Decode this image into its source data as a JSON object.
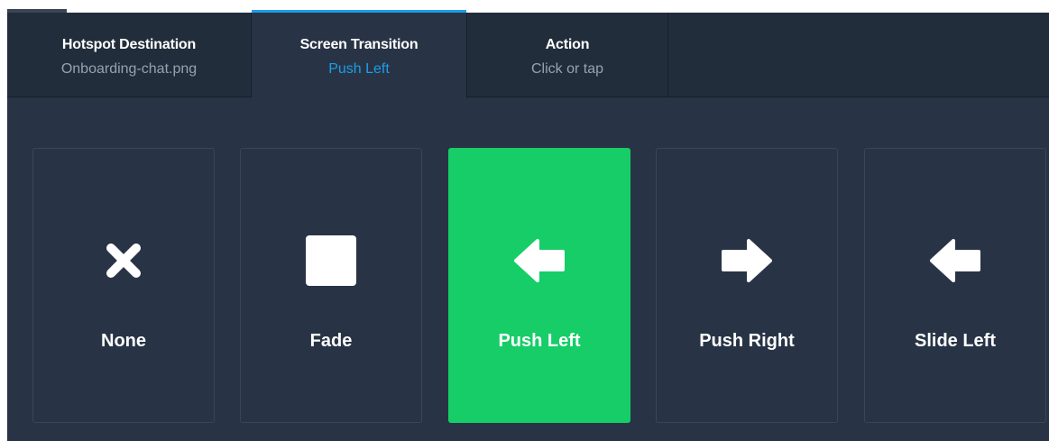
{
  "tabs": [
    {
      "title": "Hotspot Destination",
      "subtitle": "Onboarding-chat.png",
      "active": false
    },
    {
      "title": "Screen Transition",
      "subtitle": "Push Left",
      "active": true
    },
    {
      "title": "Action",
      "subtitle": "Click or tap",
      "active": false
    }
  ],
  "transitions": [
    {
      "label": "None",
      "icon": "close-icon",
      "selected": false
    },
    {
      "label": "Fade",
      "icon": "square-icon",
      "selected": false
    },
    {
      "label": "Push Left",
      "icon": "arrow-left-icon",
      "selected": true
    },
    {
      "label": "Push Right",
      "icon": "arrow-right-icon",
      "selected": false
    },
    {
      "label": "Slide Left",
      "icon": "arrow-left-icon",
      "selected": false
    }
  ],
  "colors": {
    "panel_bg": "#283445",
    "tab_bar_bg": "#222d3b",
    "accent_blue": "#1f9ce8",
    "selected_green": "#16cd68",
    "muted_text": "#97a1af"
  }
}
